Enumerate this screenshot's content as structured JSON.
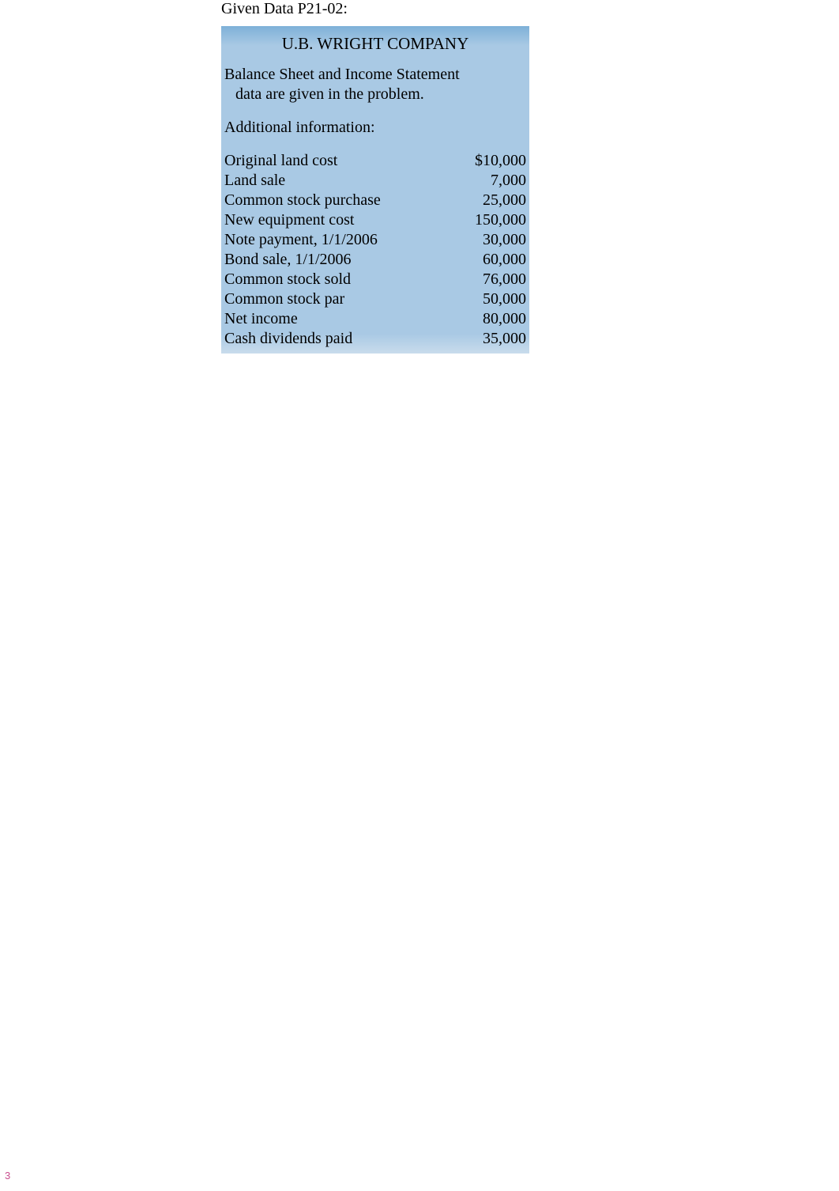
{
  "header": {
    "title": "Given Data P21-02:"
  },
  "panel": {
    "company_name": "U.B. WRIGHT COMPANY",
    "info_line1": "Balance Sheet and Income Statement",
    "info_line2": "  data are given in the problem.",
    "additional_label": "Additional information:",
    "rows": [
      {
        "label": "Original land cost",
        "value": "$10,000"
      },
      {
        "label": "Land sale",
        "value": "7,000"
      },
      {
        "label": "Common stock purchase",
        "value": "25,000"
      },
      {
        "label": "New equipment cost",
        "value": "150,000"
      },
      {
        "label": "Note payment, 1/1/2006",
        "value": "30,000"
      },
      {
        "label": "Bond sale, 1/1/2006",
        "value": "60,000"
      },
      {
        "label": "Common stock sold",
        "value": "76,000"
      },
      {
        "label": "Common stock par",
        "value": "50,000"
      },
      {
        "label": "Net income",
        "value": "80,000"
      },
      {
        "label": "Cash dividends paid",
        "value": "35,000"
      }
    ]
  },
  "footer": {
    "page_number": "3"
  }
}
